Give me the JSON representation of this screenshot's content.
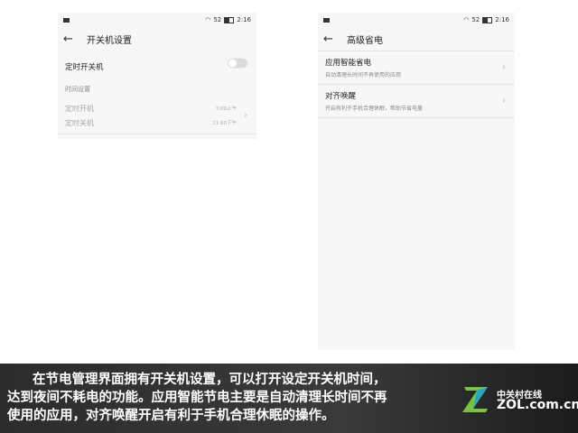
{
  "left_screen": {
    "status": {
      "signal": "52",
      "time": "2:16"
    },
    "title": "开关机设置",
    "scheduled_power_label": "定时开关机",
    "section_title": "时间设置",
    "power_on_label": "定时开机",
    "power_on_time": "7:00上午",
    "power_off_label": "定时关机",
    "power_off_time": "11:00下午",
    "toggle_on": false
  },
  "right_screen": {
    "status": {
      "signal": "52",
      "time": "2:16"
    },
    "title": "高级省电",
    "items": [
      {
        "label": "应用智能省电",
        "sub": "自动清理长时间不再使用的应用"
      },
      {
        "label": "对齐唤醒",
        "sub": "开启有利于手机合理休眠，帮助节省电量"
      }
    ]
  },
  "caption": {
    "line1": "在节电管理界面拥有开关机设置，可以打开设定开关机时间，",
    "line2": "达到夜间不耗电的功能。应用智能节电主要是自动清理长时间不再",
    "line3": "使用的应用，对齐唤醒开启有利于手机合理休眠的操作。"
  },
  "logo": {
    "cn": "中关村在线",
    "en": "ZOL.com.cn"
  },
  "colors": {
    "caption_bg": "#2f2f2f",
    "logo_green": "#7cc242",
    "logo_blue": "#1aa0d8"
  }
}
